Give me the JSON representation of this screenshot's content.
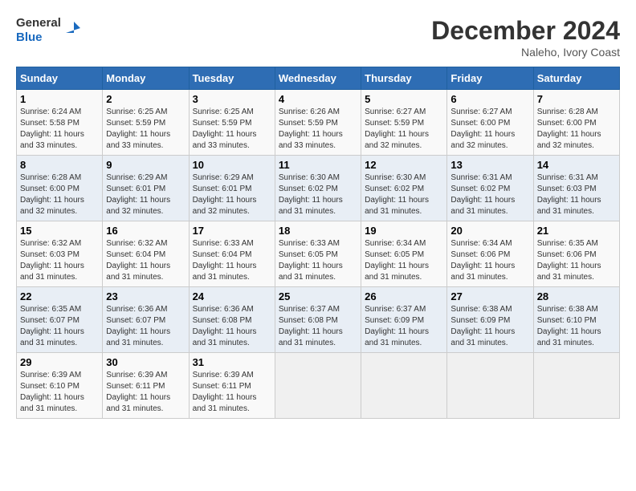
{
  "logo": {
    "line1": "General",
    "line2": "Blue"
  },
  "title": "December 2024",
  "location": "Naleho, Ivory Coast",
  "weekdays": [
    "Sunday",
    "Monday",
    "Tuesday",
    "Wednesday",
    "Thursday",
    "Friday",
    "Saturday"
  ],
  "weeks": [
    [
      {
        "day": "1",
        "sunrise": "6:24 AM",
        "sunset": "5:58 PM",
        "daylight": "11 hours and 33 minutes."
      },
      {
        "day": "2",
        "sunrise": "6:25 AM",
        "sunset": "5:59 PM",
        "daylight": "11 hours and 33 minutes."
      },
      {
        "day": "3",
        "sunrise": "6:25 AM",
        "sunset": "5:59 PM",
        "daylight": "11 hours and 33 minutes."
      },
      {
        "day": "4",
        "sunrise": "6:26 AM",
        "sunset": "5:59 PM",
        "daylight": "11 hours and 33 minutes."
      },
      {
        "day": "5",
        "sunrise": "6:27 AM",
        "sunset": "5:59 PM",
        "daylight": "11 hours and 32 minutes."
      },
      {
        "day": "6",
        "sunrise": "6:27 AM",
        "sunset": "6:00 PM",
        "daylight": "11 hours and 32 minutes."
      },
      {
        "day": "7",
        "sunrise": "6:28 AM",
        "sunset": "6:00 PM",
        "daylight": "11 hours and 32 minutes."
      }
    ],
    [
      {
        "day": "8",
        "sunrise": "6:28 AM",
        "sunset": "6:00 PM",
        "daylight": "11 hours and 32 minutes."
      },
      {
        "day": "9",
        "sunrise": "6:29 AM",
        "sunset": "6:01 PM",
        "daylight": "11 hours and 32 minutes."
      },
      {
        "day": "10",
        "sunrise": "6:29 AM",
        "sunset": "6:01 PM",
        "daylight": "11 hours and 32 minutes."
      },
      {
        "day": "11",
        "sunrise": "6:30 AM",
        "sunset": "6:02 PM",
        "daylight": "11 hours and 31 minutes."
      },
      {
        "day": "12",
        "sunrise": "6:30 AM",
        "sunset": "6:02 PM",
        "daylight": "11 hours and 31 minutes."
      },
      {
        "day": "13",
        "sunrise": "6:31 AM",
        "sunset": "6:02 PM",
        "daylight": "11 hours and 31 minutes."
      },
      {
        "day": "14",
        "sunrise": "6:31 AM",
        "sunset": "6:03 PM",
        "daylight": "11 hours and 31 minutes."
      }
    ],
    [
      {
        "day": "15",
        "sunrise": "6:32 AM",
        "sunset": "6:03 PM",
        "daylight": "11 hours and 31 minutes."
      },
      {
        "day": "16",
        "sunrise": "6:32 AM",
        "sunset": "6:04 PM",
        "daylight": "11 hours and 31 minutes."
      },
      {
        "day": "17",
        "sunrise": "6:33 AM",
        "sunset": "6:04 PM",
        "daylight": "11 hours and 31 minutes."
      },
      {
        "day": "18",
        "sunrise": "6:33 AM",
        "sunset": "6:05 PM",
        "daylight": "11 hours and 31 minutes."
      },
      {
        "day": "19",
        "sunrise": "6:34 AM",
        "sunset": "6:05 PM",
        "daylight": "11 hours and 31 minutes."
      },
      {
        "day": "20",
        "sunrise": "6:34 AM",
        "sunset": "6:06 PM",
        "daylight": "11 hours and 31 minutes."
      },
      {
        "day": "21",
        "sunrise": "6:35 AM",
        "sunset": "6:06 PM",
        "daylight": "11 hours and 31 minutes."
      }
    ],
    [
      {
        "day": "22",
        "sunrise": "6:35 AM",
        "sunset": "6:07 PM",
        "daylight": "11 hours and 31 minutes."
      },
      {
        "day": "23",
        "sunrise": "6:36 AM",
        "sunset": "6:07 PM",
        "daylight": "11 hours and 31 minutes."
      },
      {
        "day": "24",
        "sunrise": "6:36 AM",
        "sunset": "6:08 PM",
        "daylight": "11 hours and 31 minutes."
      },
      {
        "day": "25",
        "sunrise": "6:37 AM",
        "sunset": "6:08 PM",
        "daylight": "11 hours and 31 minutes."
      },
      {
        "day": "26",
        "sunrise": "6:37 AM",
        "sunset": "6:09 PM",
        "daylight": "11 hours and 31 minutes."
      },
      {
        "day": "27",
        "sunrise": "6:38 AM",
        "sunset": "6:09 PM",
        "daylight": "11 hours and 31 minutes."
      },
      {
        "day": "28",
        "sunrise": "6:38 AM",
        "sunset": "6:10 PM",
        "daylight": "11 hours and 31 minutes."
      }
    ],
    [
      {
        "day": "29",
        "sunrise": "6:39 AM",
        "sunset": "6:10 PM",
        "daylight": "11 hours and 31 minutes."
      },
      {
        "day": "30",
        "sunrise": "6:39 AM",
        "sunset": "6:11 PM",
        "daylight": "11 hours and 31 minutes."
      },
      {
        "day": "31",
        "sunrise": "6:39 AM",
        "sunset": "6:11 PM",
        "daylight": "11 hours and 31 minutes."
      },
      null,
      null,
      null,
      null
    ]
  ]
}
